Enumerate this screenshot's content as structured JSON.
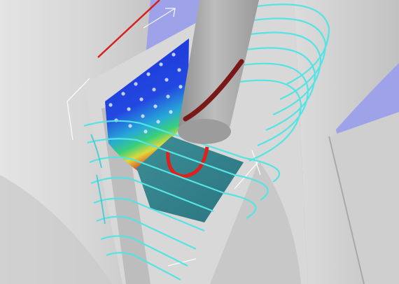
{
  "viewport": {
    "label": "",
    "colors": {
      "background": "#9ea2e8",
      "part_surface": "#d4d4d4",
      "part_shadow": "#b8b8b8",
      "blade_surface": "#2f7f8a",
      "tool_body": "#a6a6a6",
      "scan_low": "#1c2fd8",
      "scan_high": "#d8332a",
      "toolpath": "#55e3e3",
      "toolpath_secondary": "#34c9cf",
      "red_curve": "#e0201a",
      "groove": "#7a1717",
      "bbox": "#ffffff"
    }
  }
}
